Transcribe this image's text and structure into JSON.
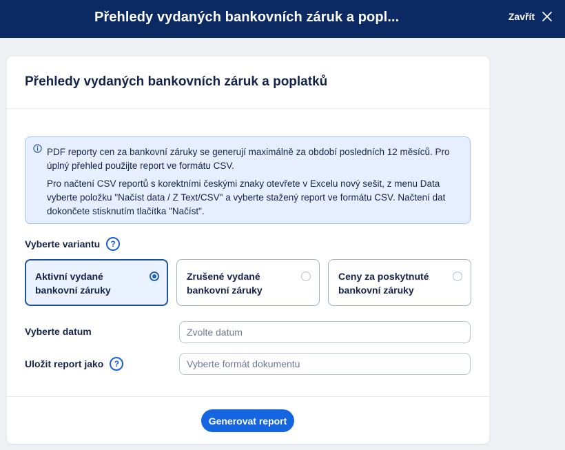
{
  "topbar": {
    "title": "Přehledy vydaných bankovních záruk a popl...",
    "close_label": "Zavřít",
    "background": "#0b2a63"
  },
  "card": {
    "title": "Přehledy vydaných bankovních záruk a poplatků"
  },
  "info": {
    "paragraph_1": "PDF reporty cen za bankovní záruky se generují maximálně za období posledních 12 měsíců. Pro úplný přehled použijte report ve formátu CSV.",
    "paragraph_2": "Pro načtení CSV reportů s korektními českými znaky otevřete v Excelu nový sešit, z menu Data vyberte položku \"Načíst data / Z Text/CSV\" a vyberte stažený report ve formátu CSV. Načtení dat dokončete stisknutím tlačítka \"Načíst\"."
  },
  "variant": {
    "label": "Vyberte variantu",
    "options": [
      {
        "label": "Aktivní vydané bankovní záruky",
        "selected": true
      },
      {
        "label": "Zrušené vydané bankovní záruky",
        "selected": false
      },
      {
        "label": "Ceny za poskytnuté bankovní záruky",
        "selected": false
      }
    ]
  },
  "date": {
    "label": "Vyberte datum",
    "value": "",
    "placeholder": "Zvolte datum"
  },
  "format": {
    "label": "Uložit report jako",
    "value": "",
    "placeholder": "Vyberte formát dokumentu"
  },
  "actions": {
    "generate_label": "Generovat report"
  },
  "colors": {
    "accent": "#1565e0",
    "info_background": "#e6efff",
    "text": "#14234b"
  },
  "icons": {
    "close": "close-icon",
    "info": "info-icon",
    "help": "help-icon"
  },
  "help_glyph": "?"
}
